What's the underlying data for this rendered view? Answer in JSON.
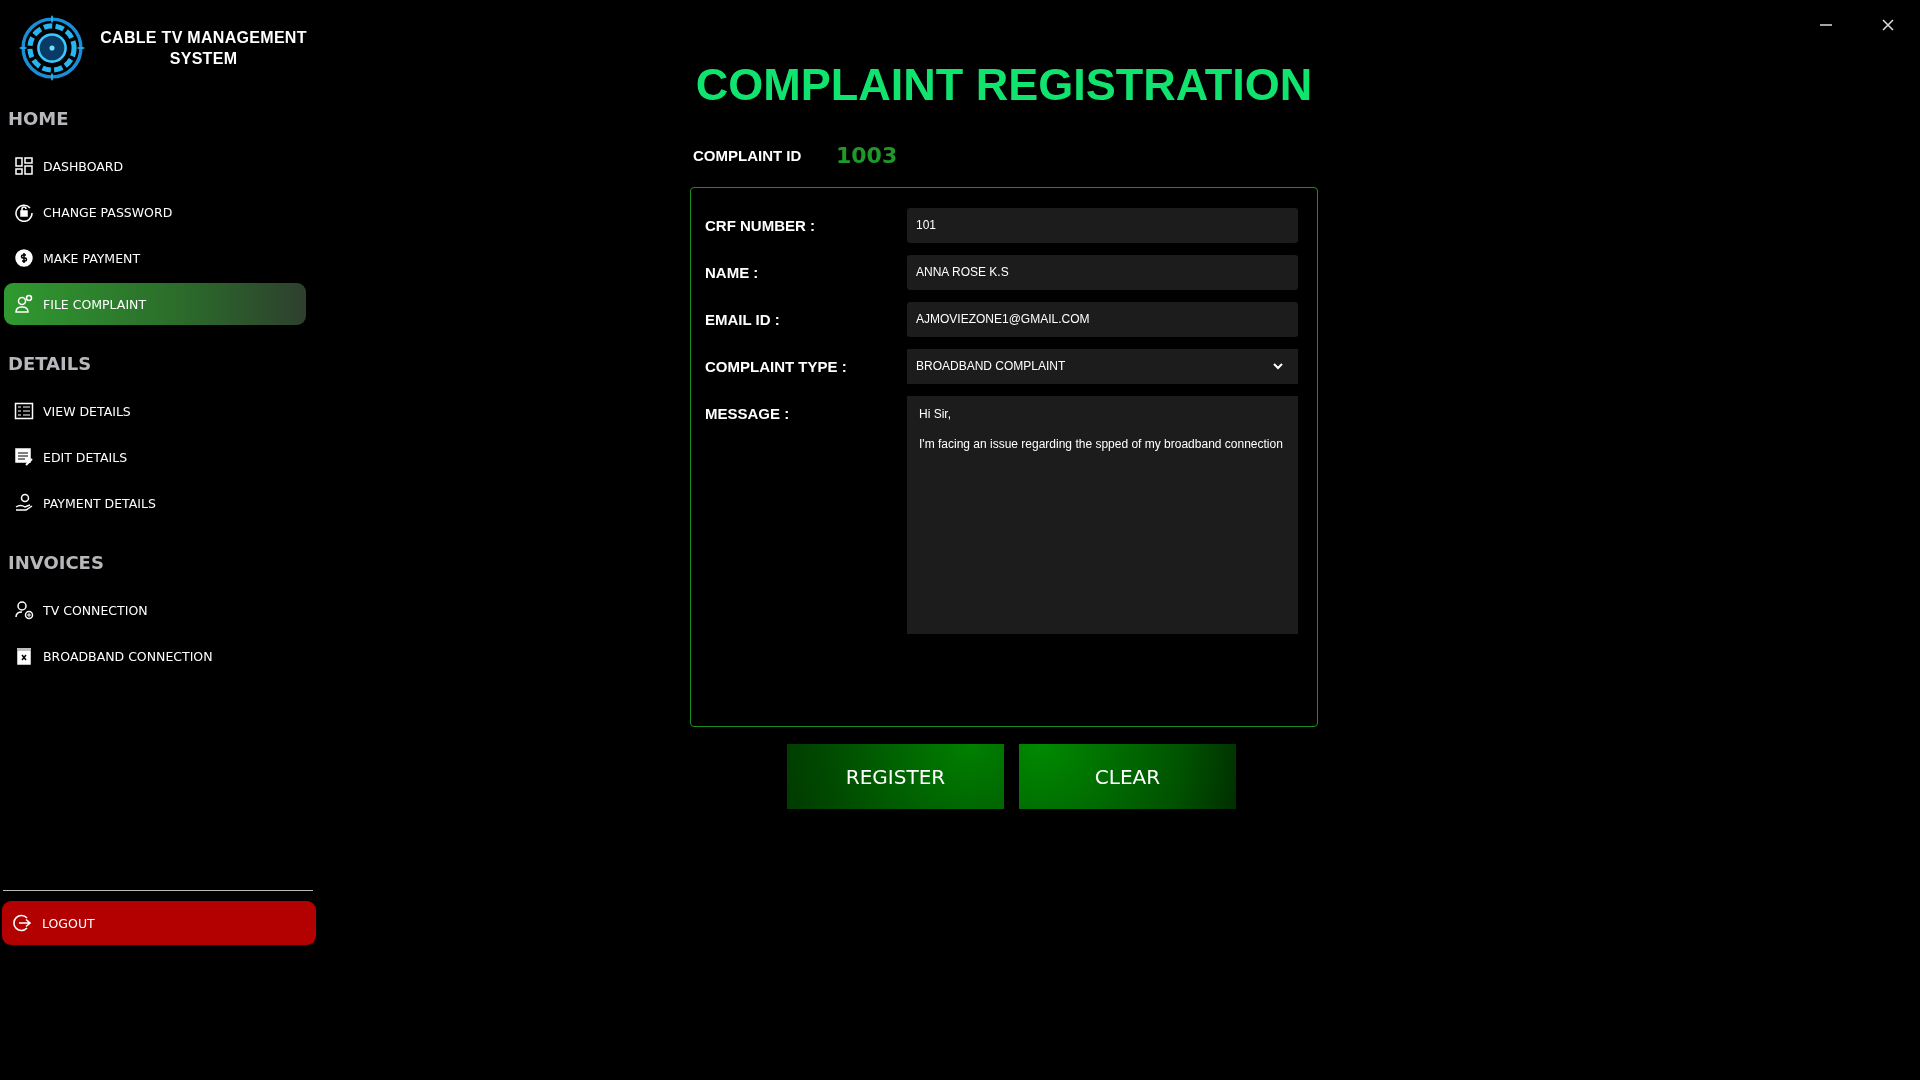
{
  "app": {
    "title": "CABLE TV MANAGEMENT SYSTEM"
  },
  "sidebar": {
    "sections": [
      {
        "heading": "HOME",
        "items": [
          {
            "label": "DASHBOARD",
            "selected": false
          },
          {
            "label": "CHANGE PASSWORD",
            "selected": false
          },
          {
            "label": "MAKE PAYMENT",
            "selected": false
          },
          {
            "label": "FILE COMPLAINT",
            "selected": true
          }
        ]
      },
      {
        "heading": "DETAILS",
        "items": [
          {
            "label": "VIEW  DETAILS",
            "selected": false
          },
          {
            "label": "EDIT DETAILS",
            "selected": false
          },
          {
            "label": "PAYMENT DETAILS",
            "selected": false
          }
        ]
      },
      {
        "heading": "INVOICES",
        "items": [
          {
            "label": "TV CONNECTION",
            "selected": false
          },
          {
            "label": "BROADBAND CONNECTION",
            "selected": false
          }
        ]
      }
    ],
    "logout": "LOGOUT"
  },
  "page": {
    "title": "COMPLAINT REGISTRATION",
    "id_label": "COMPLAINT ID",
    "id_value": "1003"
  },
  "form": {
    "fields": [
      {
        "label": "CRF NUMBER :",
        "kind": "text",
        "value": "101"
      },
      {
        "label": "NAME  :",
        "kind": "text",
        "value": "ANNA ROSE K.S"
      },
      {
        "label": "EMAIL ID :",
        "kind": "text",
        "value": "AJMOVIEZONE1@GMAIL.COM"
      },
      {
        "label": "COMPLAINT TYPE :",
        "kind": "dropdown",
        "value": "BROADBAND COMPLAINT"
      },
      {
        "label": "MESSAGE :",
        "kind": "textarea",
        "lines": [
          "Hi Sir,",
          "I'm facing an issue regarding the spped of my broadband connection"
        ]
      }
    ]
  },
  "buttons": [
    "REGISTER",
    "CLEAR"
  ]
}
